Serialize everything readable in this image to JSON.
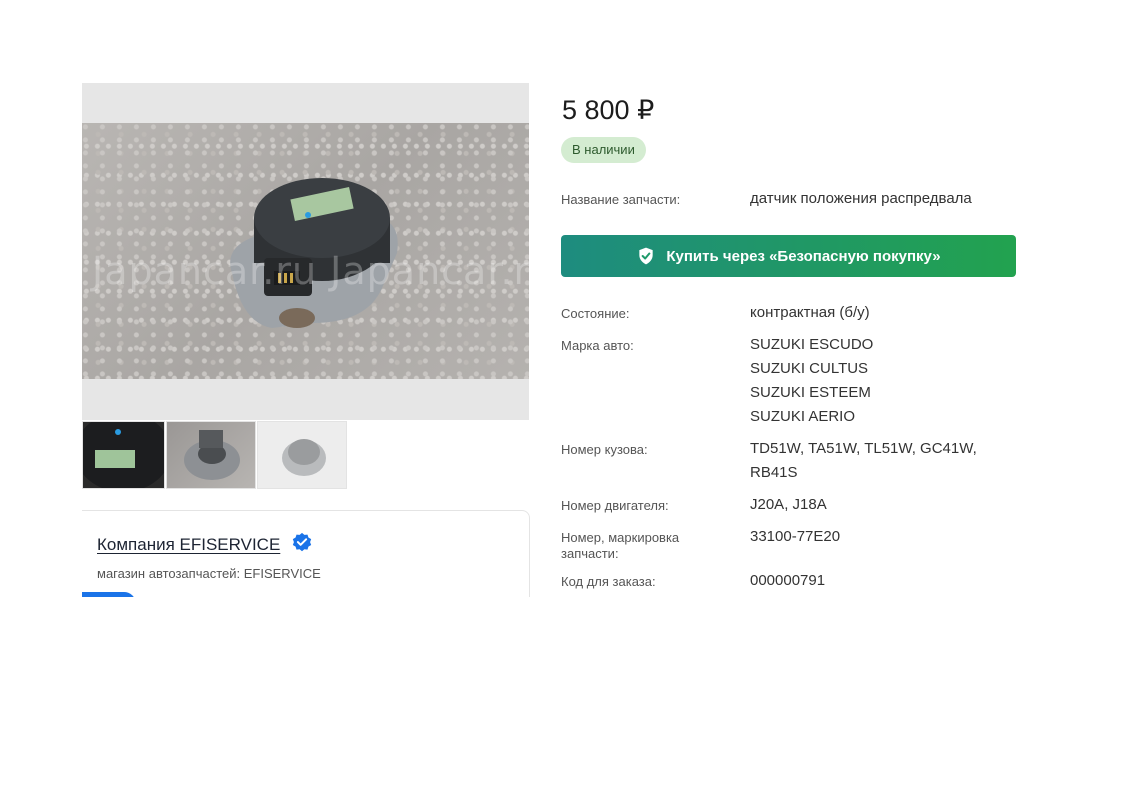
{
  "photo": {
    "watermark": "Japancar.ru  Japancar.ru"
  },
  "company": {
    "name": "Компания EFISERVICE",
    "subtitle": "магазин автозапчастей: EFISERVICE"
  },
  "product": {
    "price": "5 800 ₽",
    "stock": "В наличии",
    "part_name_label": "Название запчасти:",
    "part_name_value": "датчик положения распредвала",
    "buy_button": "Купить через «Безопасную покупку»",
    "condition_label": "Состояние:",
    "condition_value": "контрактная (б/у)",
    "brand_label": "Марка авто:",
    "brands": [
      "SUZUKI ESCUDO",
      "SUZUKI CULTUS",
      "SUZUKI ESTEEM",
      "SUZUKI AERIO"
    ],
    "body_label": "Номер кузова:",
    "body_line1": "TD51W, TA51W, TL51W, GC41W,",
    "body_line2": "RB41S",
    "engine_label": "Номер двигателя:",
    "engine_value": "J20A, J18A",
    "part_number_label_line1": "Номер, маркировка",
    "part_number_label_line2": "запчасти:",
    "part_number_value": "33100-77E20",
    "order_code_label": "Код для заказа:",
    "order_code_value": "000000791"
  },
  "colors": {
    "buy_start": "#1e8c7f",
    "buy_end": "#22a24f",
    "stock_bg": "#d4ecd1",
    "verified": "#1a73e8"
  }
}
